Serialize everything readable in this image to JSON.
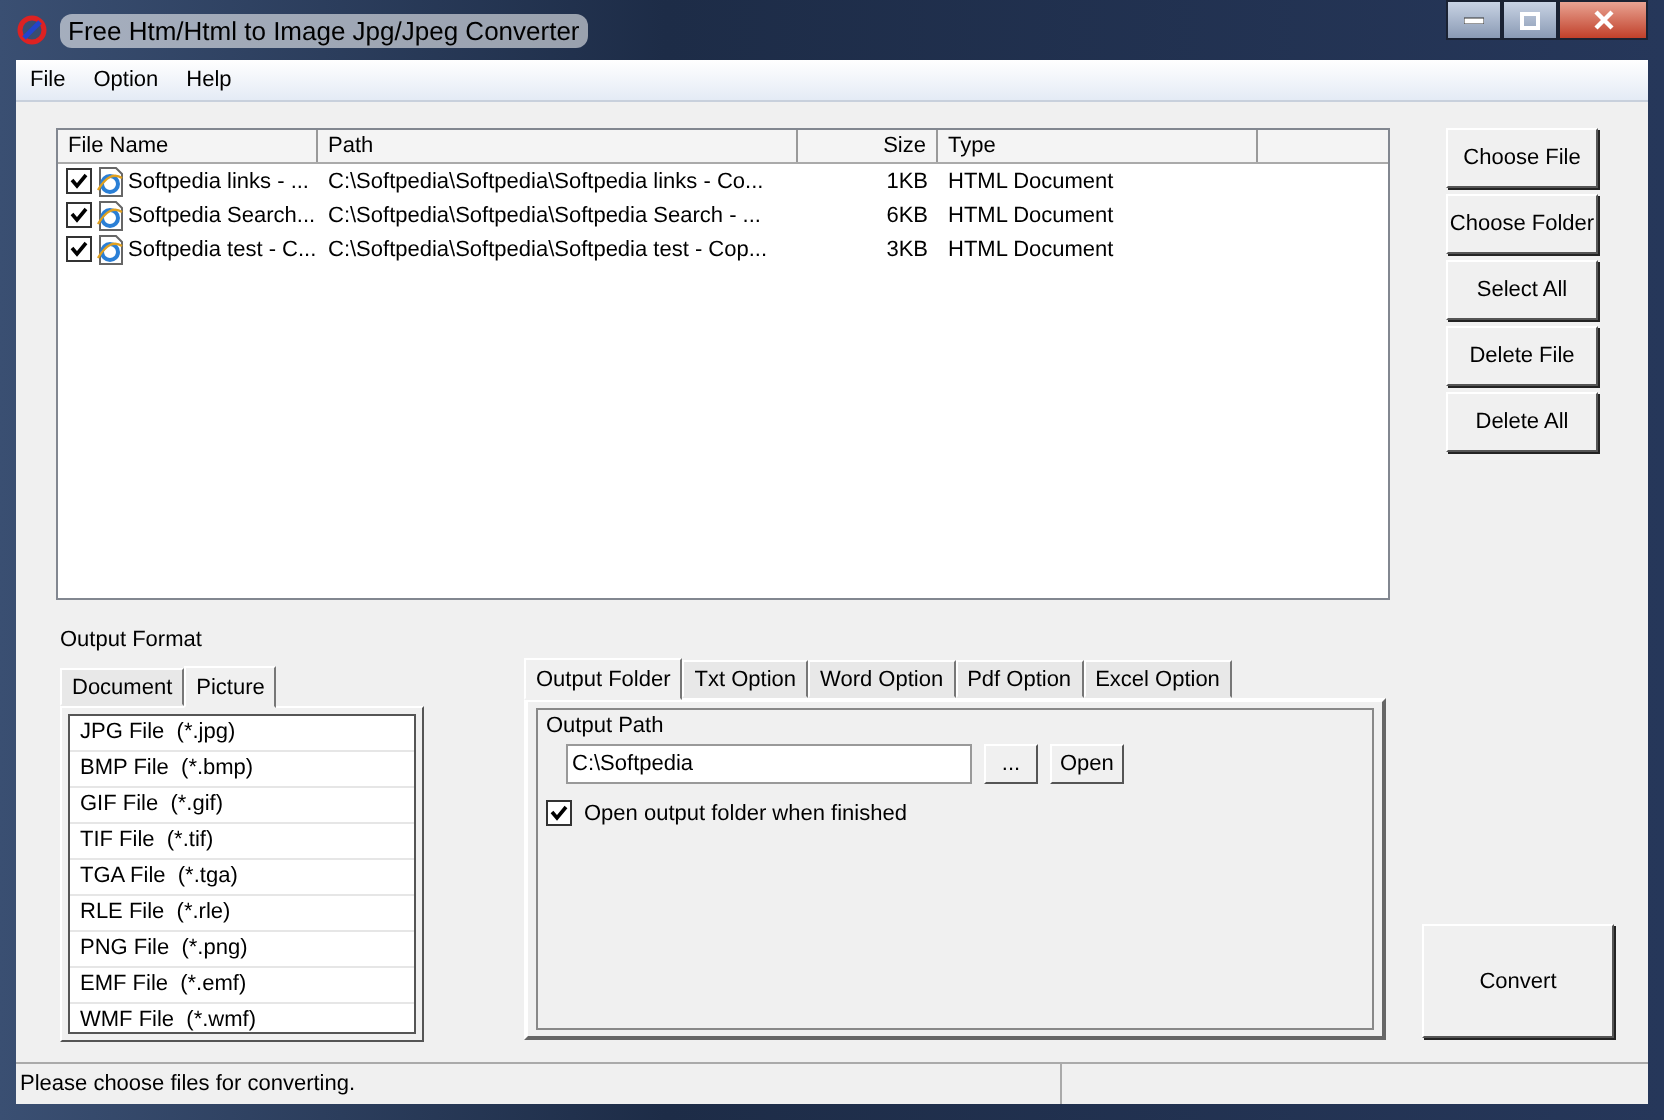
{
  "window": {
    "title": "Free Htm/Html to Image Jpg/Jpeg Converter"
  },
  "menu": [
    "File",
    "Option",
    "Help"
  ],
  "file_list": {
    "columns": [
      "File Name",
      "Path",
      "Size",
      "Type"
    ],
    "rows": [
      {
        "checked": true,
        "file_name": "Softpedia links - ...",
        "path": "C:\\Softpedia\\Softpedia\\Softpedia links - Co...",
        "size": "1KB",
        "type": "HTML Document"
      },
      {
        "checked": true,
        "file_name": "Softpedia Search...",
        "path": "C:\\Softpedia\\Softpedia\\Softpedia Search - ...",
        "size": "6KB",
        "type": "HTML Document"
      },
      {
        "checked": true,
        "file_name": "Softpedia test - C...",
        "path": "C:\\Softpedia\\Softpedia\\Softpedia test - Cop...",
        "size": "3KB",
        "type": "HTML Document"
      }
    ]
  },
  "side_buttons": [
    "Choose File",
    "Choose Folder",
    "Select All",
    "Delete File",
    "Delete All"
  ],
  "output_format": {
    "label": "Output Format",
    "tabs": [
      {
        "label": "Document",
        "selected": false
      },
      {
        "label": "Picture",
        "selected": true
      }
    ],
    "formats": [
      "JPG File  (*.jpg)",
      "BMP File  (*.bmp)",
      "GIF File  (*.gif)",
      "TIF File  (*.tif)",
      "TGA File  (*.tga)",
      "RLE File  (*.rle)",
      "PNG File  (*.png)",
      "EMF File  (*.emf)",
      "WMF File  (*.wmf)"
    ]
  },
  "option_tabs": [
    {
      "label": "Output Folder",
      "selected": true
    },
    {
      "label": "Txt Option",
      "selected": false
    },
    {
      "label": "Word Option",
      "selected": false
    },
    {
      "label": "Pdf Option",
      "selected": false
    },
    {
      "label": "Excel Option",
      "selected": false
    }
  ],
  "output_path": {
    "label": "Output Path",
    "value": "C:\\Softpedia",
    "browse_button": "...",
    "open_button": "Open"
  },
  "open_when_finished": {
    "label": "Open output folder when finished",
    "checked": true
  },
  "convert_button": "Convert",
  "status_bar": {
    "text": "Please choose files for converting."
  }
}
